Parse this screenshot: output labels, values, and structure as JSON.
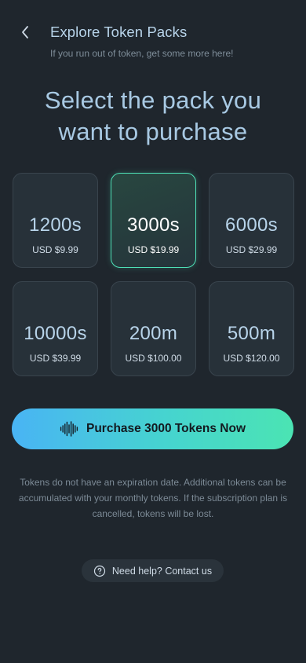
{
  "header": {
    "title": "Explore Token Packs",
    "subtitle": "If you run out of token, get some more here!",
    "back_icon": "chevron-left-icon"
  },
  "headline": {
    "line1": "Select the pack you",
    "line2": "want to purchase"
  },
  "packs": [
    {
      "amount": "1200s",
      "price": "USD $9.99",
      "selected": false
    },
    {
      "amount": "3000s",
      "price": "USD $19.99",
      "selected": true
    },
    {
      "amount": "6000s",
      "price": "USD $29.99",
      "selected": false
    },
    {
      "amount": "10000s",
      "price": "USD $39.99",
      "selected": false
    },
    {
      "amount": "200m",
      "price": "USD $100.00",
      "selected": false
    },
    {
      "amount": "500m",
      "price": "USD $120.00",
      "selected": false
    }
  ],
  "pack_icon": "sound-wave-icon",
  "cta": {
    "label": "Purchase 3000 Tokens Now",
    "icon": "sound-wave-icon"
  },
  "note": "Tokens do not have an expiration date. Additional tokens can be accumulated with your monthly tokens. If the subscription plan is cancelled, tokens will be lost.",
  "help": {
    "label": "Need help? Contact us",
    "icon": "question-circle-icon"
  },
  "colors": {
    "background": "#1f262d",
    "accent_teal": "#4ee0b6",
    "accent_blue": "#49b4f4",
    "card": "#273139"
  }
}
